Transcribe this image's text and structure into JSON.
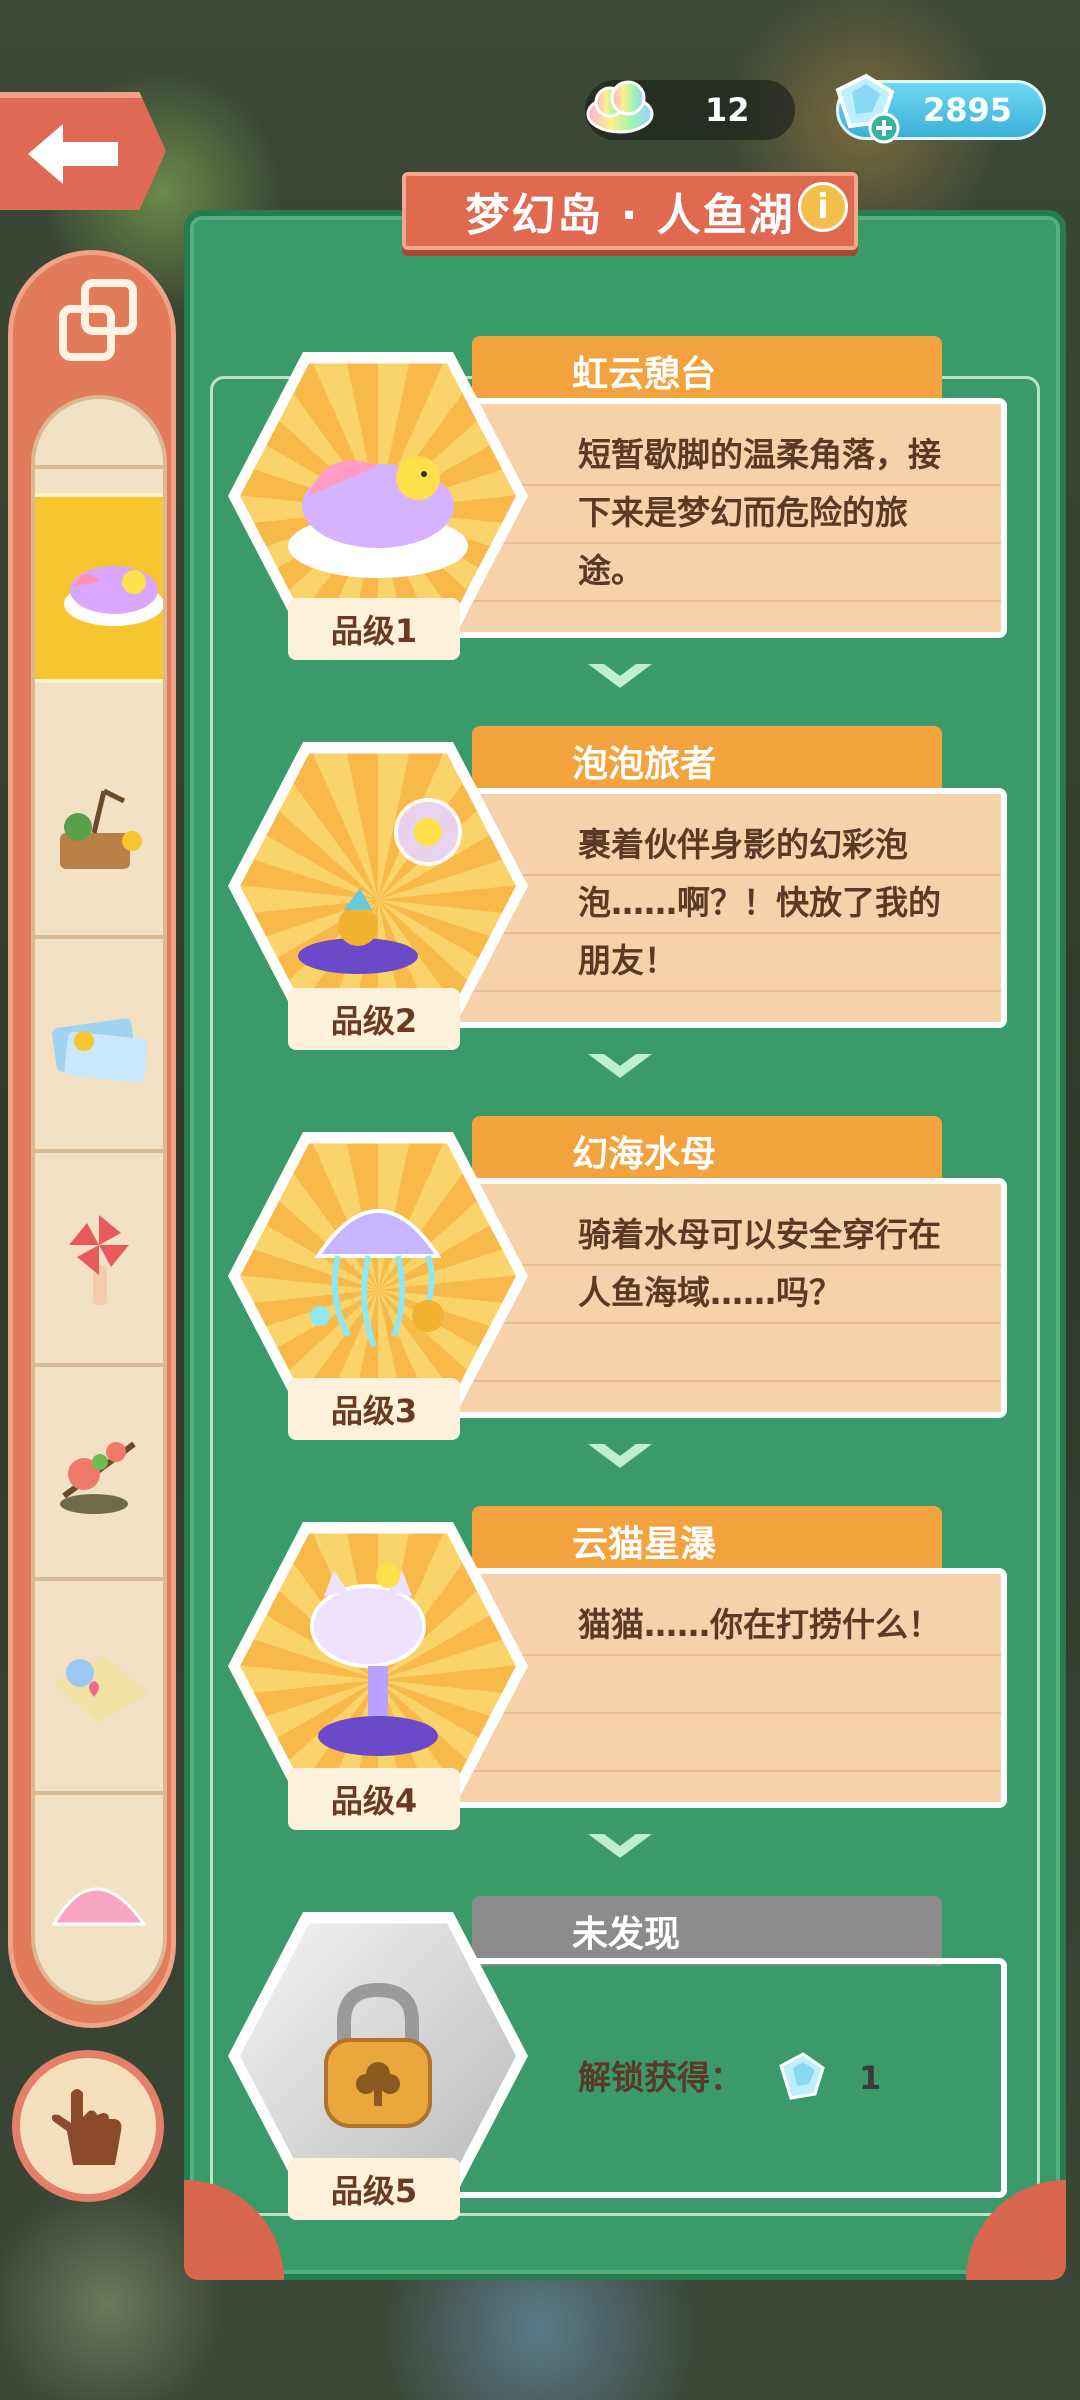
{
  "topbar": {
    "back_icon": "arrow-left-icon",
    "cloud_count": "12",
    "gem_count": "2895"
  },
  "panel": {
    "title": "梦幻岛 · 人鱼湖",
    "info_icon": "i"
  },
  "entries": [
    {
      "name": "虹云憩台",
      "desc": "短暂歇脚的温柔角落，接下来是梦幻而危险的旅途。",
      "grade": "品级1"
    },
    {
      "name": "泡泡旅者",
      "desc": "裹着伙伴身影的幻彩泡泡……啊？！快放了我的朋友！",
      "grade": "品级2"
    },
    {
      "name": "幻海水母",
      "desc": "骑着水母可以安全穿行在人鱼海域……吗？",
      "grade": "品级3"
    },
    {
      "name": "云猫星瀑",
      "desc": "猫猫……你在打捞什么！",
      "grade": "品级4"
    }
  ],
  "locked": {
    "name": "未发现",
    "unlock_label": "解锁获得：",
    "unlock_count": "1",
    "grade": "品级5"
  },
  "colors": {
    "panel_green": "#3a9a69",
    "banner_red": "#df6a50",
    "tab_orange": "#f2a33e",
    "card_beige": "#f6d2aa",
    "selected_yellow": "#f7c62e"
  }
}
